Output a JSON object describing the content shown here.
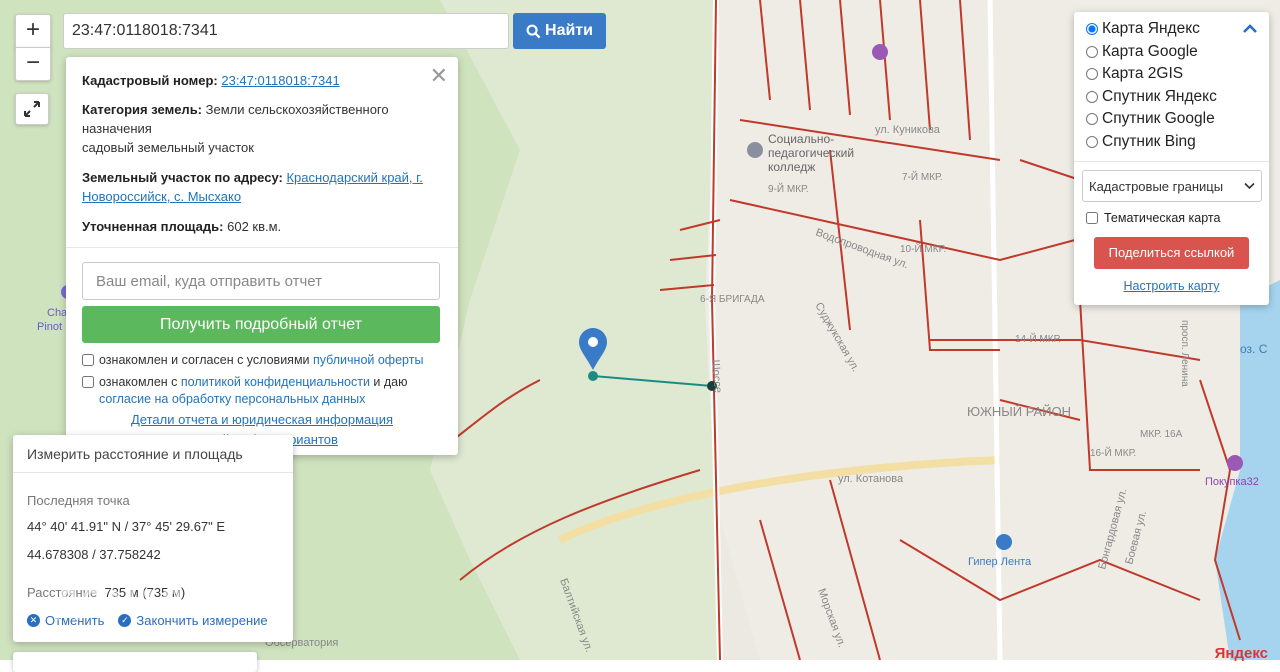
{
  "search": {
    "value": "23:47:0118018:7341",
    "button_label": "Найти"
  },
  "zoom": {
    "in_label": "+",
    "out_label": "−"
  },
  "info": {
    "cadastral_label": "Кадастровый номер:",
    "cadastral_value": "23:47:0118018:7341",
    "category_label": "Категория земель:",
    "category_value_1": "Земли сельскохозяйственного назначения",
    "category_value_2": "садовый земельный участок",
    "address_label": "Земельный участок по адресу:",
    "address_value": "Краснодарский край, г. Новороссийск, с. Мысхако",
    "area_label": "Уточненная площадь:",
    "area_value": "602 кв.м.",
    "email_placeholder": "Ваш email, куда отправить отчет",
    "report_button": "Получить подробный отчет",
    "consent1_pre": "ознакомлен и согласен с условиями ",
    "consent1_link": "публичной оферты",
    "consent2_pre": "ознакомлен с ",
    "consent2_link": "политикой конфиденциальности",
    "consent2_mid": " и даю",
    "consent2_link2": "согласие на обработку персональных данных",
    "details_link": "Детали отчета и юридическая информация",
    "manual_link": "Ручной выбор вариантов"
  },
  "layers": {
    "options": [
      "Карта Яндекс",
      "Карта Google",
      "Карта 2GIS",
      "Спутник Яндекс",
      "Спутник Google",
      "Спутник Bing"
    ],
    "selected": "Карта Яндекс",
    "cadastral_select": "Кадастровые границы",
    "thematic_label": "Тематическая карта",
    "share_button": "Поделиться ссылкой",
    "configure_link": "Настроить карту"
  },
  "measure": {
    "title": "Измерить расстояние и площадь",
    "last_point_label": "Последняя точка",
    "dms": "44° 40' 41.91\" N / 37° 45' 29.67\" E",
    "decimal": "44.678308 / 37.758242",
    "distance_label": "Расстояние",
    "distance_value": "735 м (735 м)",
    "cancel_label": "Отменить",
    "finish_label": "Закончить измерение"
  },
  "map_labels": {
    "college_1": "Социально-",
    "college_2": "педагогический",
    "college_3": "колледж",
    "mkr7": "7-Й МКР.",
    "mkr9": "9-Й МКР.",
    "mkr10": "10-Й МКР.",
    "mkr14": "14-Й МКР.",
    "mkr16a": "МКР. 16А",
    "mkr16": "16-Й МКР.",
    "district": "ЮЖНЫЙ РАЙОН",
    "brigade": "6-Я БРИГАДА",
    "st_kunikova": "ул. Куникова",
    "st_kotanova": "ул. Котанова",
    "st_sudzhukskaya": "Суджукская ул.",
    "st_vodoprovodnaya": "Водопроводная ул.",
    "hyper": "Гипер Лента",
    "observatory": "Обсерватория",
    "st_baltiyskaya": "Балтийская ул.",
    "st_morskaya": "Морская ул.",
    "st_bongardovaya": "Бонгардовая ул.",
    "st_boevaya": "Боевая ул.",
    "chalet": "Chalet",
    "pinot": "Pinot",
    "oz": "оз. С",
    "prospekt_lenina": "просп. Ленина",
    "shosse": "Шоссе",
    "pokupka": "Покупка32"
  },
  "watermark": "ДОМКЛИК",
  "copyright": "Яндекс",
  "colors": {
    "boundary": "#c0392b",
    "accent": "#3a7bc8",
    "green_button": "#5cb85c",
    "red_button": "#d9534f"
  }
}
